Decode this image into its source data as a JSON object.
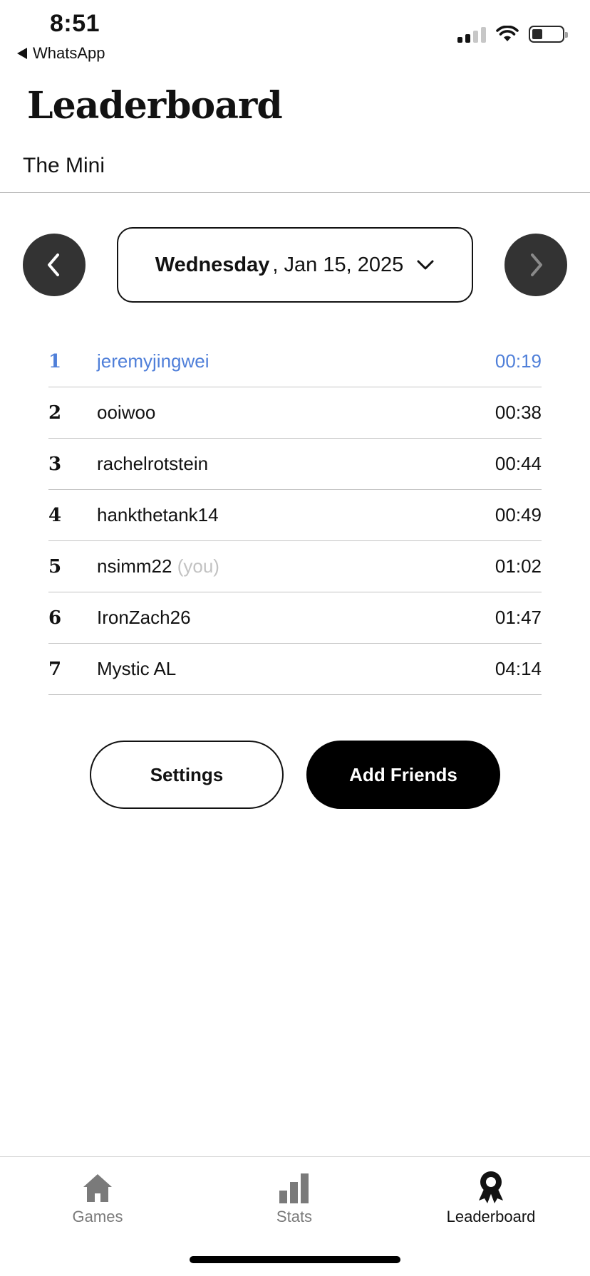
{
  "status_bar": {
    "time": "8:51",
    "back_app": "WhatsApp"
  },
  "header": {
    "title": "Leaderboard",
    "subtitle": "The Mini"
  },
  "date_selector": {
    "day": "Wednesday",
    "date": ", Jan 15, 2025"
  },
  "leaderboard": {
    "rows": [
      {
        "rank": "1",
        "name": "jeremyjingwei",
        "suffix": "",
        "time": "00:19"
      },
      {
        "rank": "2",
        "name": "ooiwoo",
        "suffix": "",
        "time": "00:38"
      },
      {
        "rank": "3",
        "name": "rachelrotstein",
        "suffix": "",
        "time": "00:44"
      },
      {
        "rank": "4",
        "name": "hankthetank14",
        "suffix": "",
        "time": "00:49"
      },
      {
        "rank": "5",
        "name": "nsimm22",
        "suffix": "(you)",
        "time": "01:02"
      },
      {
        "rank": "6",
        "name": "IronZach26",
        "suffix": "",
        "time": "01:47"
      },
      {
        "rank": "7",
        "name": "Mystic AL",
        "suffix": "",
        "time": "04:14"
      }
    ]
  },
  "buttons": {
    "settings": "Settings",
    "add_friends": "Add Friends"
  },
  "tabs": [
    {
      "label": "Games",
      "icon": "home-icon"
    },
    {
      "label": "Stats",
      "icon": "bar-chart-icon"
    },
    {
      "label": "Leaderboard",
      "icon": "ribbon-icon"
    }
  ],
  "colors": {
    "leader_highlight": "#4f7fd9",
    "nav_button": "#333333"
  }
}
